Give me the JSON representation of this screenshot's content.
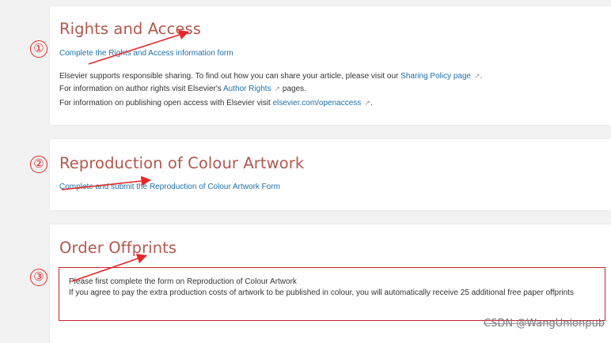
{
  "sections": {
    "rights": {
      "title": "Rights and Access",
      "form_link": "Complete the Rights and Access information form",
      "sharing_prefix": "Elsevier supports responsible sharing. To find out how you can share your article, please visit our ",
      "sharing_link": "Sharing Policy page",
      "sharing_suffix": ".",
      "author_prefix": "For information on author rights visit Elsevier's ",
      "author_link": "Author Rights",
      "author_suffix": " pages.",
      "oa_prefix": "For information on publishing open access with Elsevier visit ",
      "oa_link": "elsevier.com/openaccess",
      "oa_suffix": "."
    },
    "colour": {
      "title": "Reproduction of Colour Artwork",
      "form_link": "Complete and submit the Reproduction of Colour Artwork Form"
    },
    "offprints": {
      "title": "Order Offprints",
      "line1": "Please first complete the form on Reproduction of Colour Artwork",
      "line2": "If you agree to pay the extra production costs of artwork to be published in colour, you will automatically receive 25 additional free paper offprints"
    }
  },
  "external_icon": "↗",
  "markers": [
    "①",
    "②",
    "③"
  ],
  "watermark": "CSDN @WangUnionpub",
  "colors": {
    "heading": "#b4574d",
    "link": "#1f70a8",
    "annotation": "#e8262a",
    "highlight_box": "#c9252c",
    "background": "#f2f2f2"
  }
}
